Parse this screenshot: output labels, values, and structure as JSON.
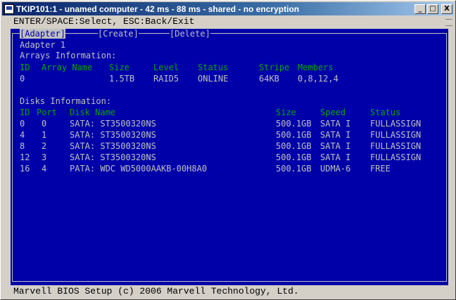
{
  "window": {
    "title": "TKIP101:1 - unamed computer - 42 ms - 88 ms - shared - no encryption",
    "minimize_glyph": "_",
    "maximize_glyph": "□",
    "close_glyph": "X"
  },
  "menubar": {
    "hint": "ENTER/SPACE:Select, ESC:Back/Exit"
  },
  "tabs": [
    {
      "label": "[Adapter]"
    },
    {
      "label": "[Create]"
    },
    {
      "label": "[Delete]"
    }
  ],
  "adapter": {
    "name": "Adapter 1",
    "arrays_heading": "Arrays Information:",
    "array_headers": {
      "id": "ID",
      "name": "Array Name",
      "size": "Size",
      "level": "Level",
      "status": "Status",
      "stripe": "Stripe",
      "members": "Members"
    },
    "arrays": [
      {
        "id": "0",
        "name": "",
        "size": "1.5TB",
        "level": "RAID5",
        "status": "ONLINE",
        "stripe": "64KB",
        "members": "0,8,12,4"
      }
    ],
    "disks_heading": "Disks Information:",
    "disk_headers": {
      "id": "ID",
      "port": "Port",
      "name": "Disk Name",
      "size": "Size",
      "speed": "Speed",
      "status": "Status"
    },
    "disks": [
      {
        "id": "0",
        "port": "0",
        "name": "SATA: ST3500320NS",
        "size": "500.1GB",
        "speed": "SATA I",
        "status": "FULLASSIGN"
      },
      {
        "id": "4",
        "port": "1",
        "name": "SATA: ST3500320NS",
        "size": "500.1GB",
        "speed": "SATA I",
        "status": "FULLASSIGN"
      },
      {
        "id": "8",
        "port": "2",
        "name": "SATA: ST3500320NS",
        "size": "500.1GB",
        "speed": "SATA I",
        "status": "FULLASSIGN"
      },
      {
        "id": "12",
        "port": "3",
        "name": "SATA: ST3500320NS",
        "size": "500.1GB",
        "speed": "SATA I",
        "status": "FULLASSIGN"
      },
      {
        "id": "16",
        "port": "4",
        "name": "PATA: WDC WD5000AAKB-00H8A0",
        "size": "500.1GB",
        "speed": "UDMA-6",
        "status": "FREE"
      }
    ]
  },
  "statusbar": {
    "text": "Marvell BIOS Setup (c) 2006 Marvell Technology, Ltd."
  },
  "colors": {
    "screen_bg": "#0000a8",
    "text": "#c0c0c0",
    "header": "#00a800"
  }
}
